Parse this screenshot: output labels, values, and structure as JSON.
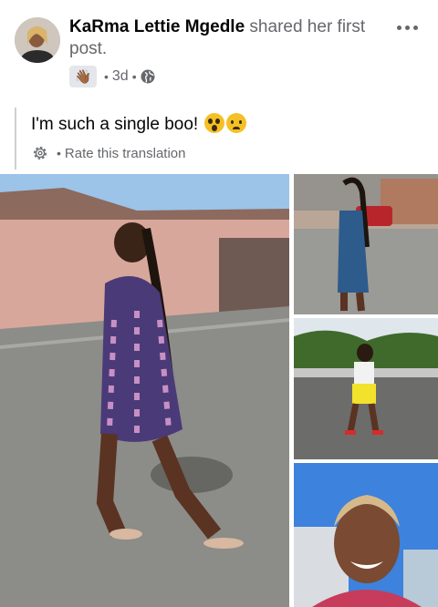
{
  "post": {
    "author": "KaRma Lettie Mgedle",
    "action": " shared her first post.",
    "time": "3d",
    "dot": "•",
    "audience_icon": "globe-icon",
    "badge_icon": "wave-icon",
    "badge_emoji": "👋🏾",
    "more_icon": "more-options-icon"
  },
  "translation": {
    "text": "I'm such a single boo!",
    "emojis": [
      "flushed-face-emoji",
      "worried-face-emoji"
    ],
    "rate_label": "Rate this translation",
    "settings_icon": "gear-icon"
  },
  "photos": [
    {
      "name": "photo-woman-walking-street"
    },
    {
      "name": "photo-woman-denim-dress"
    },
    {
      "name": "photo-woman-yellow-shorts"
    },
    {
      "name": "photo-woman-smiling-selfie"
    }
  ],
  "colors": {
    "text_primary": "#050505",
    "text_secondary": "#65676b",
    "divider": "#ccd0d5"
  }
}
